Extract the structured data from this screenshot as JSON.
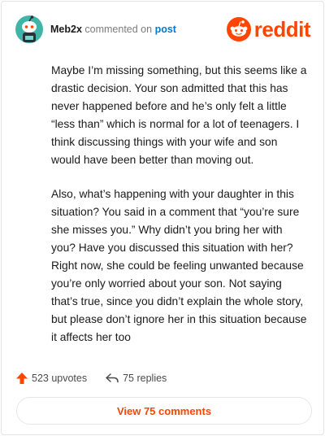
{
  "colors": {
    "accent": "#ff4500",
    "link": "#0079d3",
    "avatar_bg": "#3fb5a8"
  },
  "comment": {
    "username": "Meb2x",
    "commented_text": "commented on",
    "post_link": "post",
    "paragraphs": [
      "Maybe I’m missing something, but this seems like a drastic decision. Your son admitted that this has never happened before and he’s only felt a little “less than” which is normal for a lot of teenagers. I think discussing things with your wife and son would have been better than moving out.",
      "Also, what’s happening with your daughter in this situation? You said in a comment that “you’re sure she misses you.” Why didn’t you bring her with you? Have you discussed this situation with her? Right now, she could be feeling unwanted because you’re only worried about your son. Not saying that’s true, since you didn’t explain the whole story, but please don’t ignore her in this situation because it affects her too"
    ]
  },
  "logo": {
    "text": "reddit",
    "icon": "reddit-alien-icon"
  },
  "actions": {
    "upvotes": "523 upvotes",
    "replies": "75 replies",
    "upvote_icon": "upvote-arrow-icon",
    "reply_icon": "reply-arrow-icon"
  },
  "view_comments_label": "View 75 comments"
}
